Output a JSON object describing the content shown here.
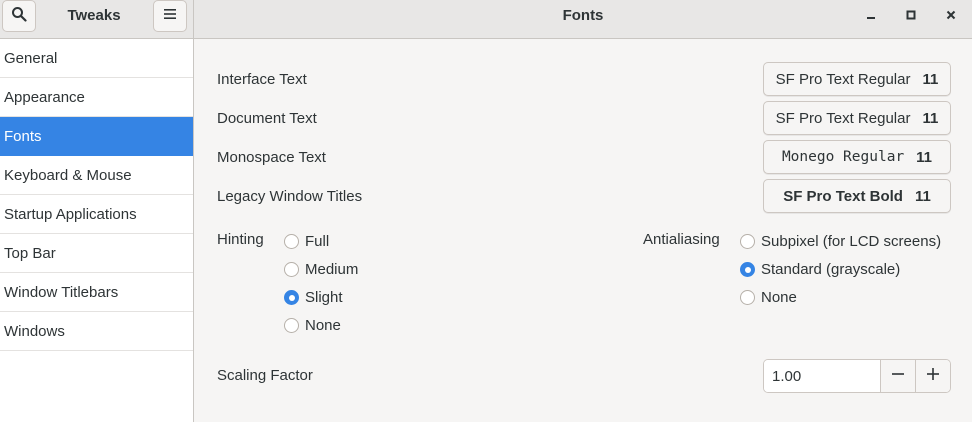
{
  "header": {
    "sidebar_title": "Tweaks",
    "title": "Fonts",
    "search_icon": "search-icon",
    "menu_icon": "hamburger-menu-icon"
  },
  "window_controls": [
    "minimize-icon",
    "maximize-icon",
    "close-icon"
  ],
  "sidebar": {
    "active": "Fonts",
    "items": [
      {
        "label": "General"
      },
      {
        "label": "Appearance"
      },
      {
        "label": "Fonts"
      },
      {
        "label": "Keyboard & Mouse"
      },
      {
        "label": "Startup Applications"
      },
      {
        "label": "Top Bar"
      },
      {
        "label": "Window Titlebars"
      },
      {
        "label": "Windows"
      }
    ]
  },
  "fonts": [
    {
      "label": "Interface Text",
      "font": "SF Pro Text Regular",
      "size": "11"
    },
    {
      "label": "Document Text",
      "font": "SF Pro Text Regular",
      "size": "11"
    },
    {
      "label": "Monospace Text",
      "font": "Monego Regular",
      "size": "11"
    },
    {
      "label": "Legacy Window Titles",
      "font": "SF Pro Text Bold",
      "size": "11"
    }
  ],
  "hinting": {
    "label": "Hinting",
    "selected": "Slight",
    "options": [
      "Full",
      "Medium",
      "Slight",
      "None"
    ]
  },
  "antialiasing": {
    "label": "Antialiasing",
    "selected": "Standard (grayscale)",
    "options": [
      "Subpixel (for LCD screens)",
      "Standard (grayscale)",
      "None"
    ]
  },
  "scaling": {
    "label": "Scaling Factor",
    "value": "1.00"
  },
  "colors": {
    "accent": "#3584e4",
    "background": "#f6f5f4",
    "sidebar": "#ffffff",
    "headerbar": "#e8e7e6"
  }
}
